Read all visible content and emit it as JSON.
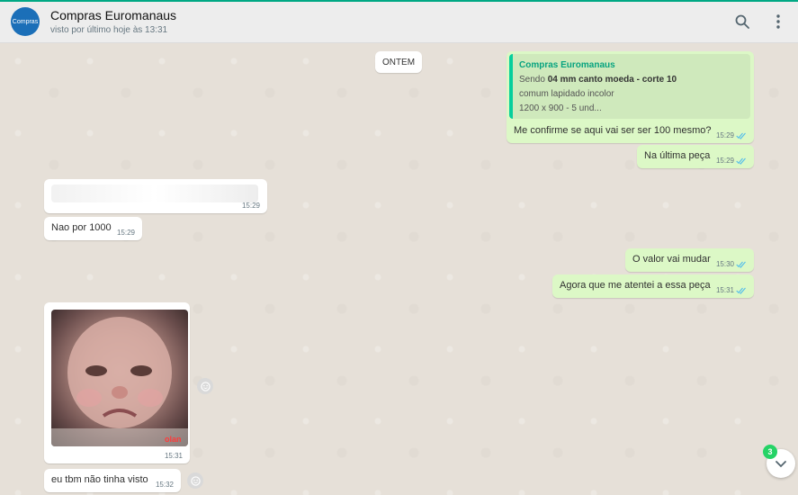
{
  "header": {
    "avatar_text": "Compras",
    "title": "Compras Euromanaus",
    "status": "visto por último hoje às 13:31"
  },
  "chat": {
    "date_chip": "ONTEM",
    "quote": {
      "author": "Compras Euromanaus",
      "line1_prefix": "Sendo ",
      "line1_bold": "04 mm canto moeda - corte 10",
      "line2": "comum lapidado incolor",
      "line3": "1200 x 900 - 5 und..."
    },
    "messages": [
      {
        "text": "Me confirme se aqui vai ser ser 100 mesmo?",
        "time": "15:29"
      },
      {
        "text": "Na última peça",
        "time": "15:29"
      },
      {
        "text": "",
        "time": "15:29"
      },
      {
        "text": "Nao por 1000",
        "time": "15:29"
      },
      {
        "text": "O valor vai mudar",
        "time": "15:30"
      },
      {
        "text": "Agora que me atentei a essa peça",
        "time": "15:31"
      },
      {
        "text": "",
        "time": "15:31"
      },
      {
        "text": "eu tbm não tinha visto",
        "time": "15:32"
      }
    ],
    "image_caption": "olan",
    "unread_count": "3"
  },
  "colors": {
    "accent": "#00a884",
    "outgoing_bubble": "#dcf8c6",
    "incoming_bubble": "#ffffff",
    "read_ticks": "#53bdeb"
  },
  "icons": [
    "search-icon",
    "menu-icon",
    "double-check-icon",
    "emoji-react-icon",
    "chevron-down-icon"
  ]
}
